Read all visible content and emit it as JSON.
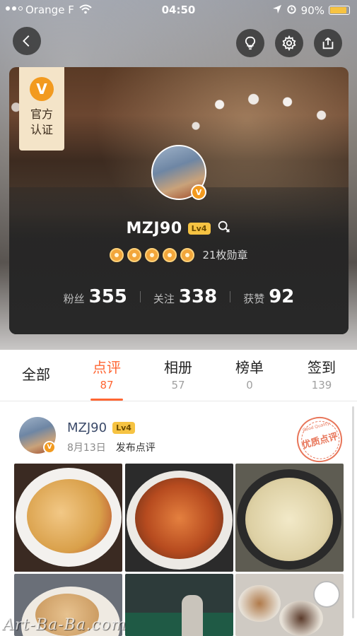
{
  "status_bar": {
    "carrier": "Orange F",
    "time": "04:50",
    "battery": "90%",
    "battery_level": 0.9,
    "icons": [
      "signal-icon",
      "wifi-icon",
      "location-icon",
      "alarm-icon",
      "battery-icon"
    ]
  },
  "header_buttons": {
    "back": "back-icon",
    "hint": "lightbulb-icon",
    "settings": "gear-icon",
    "share": "share-icon"
  },
  "profile": {
    "official_badge_letter": "V",
    "official_badge_text": "官方\n认证",
    "avatar_badge_letter": "V",
    "username": "MZJ90",
    "level": "Lv4",
    "medals_count_text": "21枚勋章",
    "medal_icons": 5,
    "stats": [
      {
        "label": "粉丝",
        "value": "355"
      },
      {
        "label": "关注",
        "value": "338"
      },
      {
        "label": "获赞",
        "value": "92"
      }
    ]
  },
  "tabs": [
    {
      "label": "全部",
      "count": ""
    },
    {
      "label": "点评",
      "count": "87",
      "active": true
    },
    {
      "label": "相册",
      "count": "57"
    },
    {
      "label": "榜单",
      "count": "0"
    },
    {
      "label": "签到",
      "count": "139"
    }
  ],
  "post": {
    "username": "MZJ90",
    "level": "Lv4",
    "avatar_badge_letter": "V",
    "date": "8月13日",
    "action": "发布点评",
    "stamp_text": "优质点评",
    "stamp_sub": "Good Quality"
  },
  "watermark": "Art-Ba-Ba.com",
  "colors": {
    "accent": "#ff6633",
    "level_badge": "#f6c342",
    "official_orange": "#f29a1f",
    "username_blue": "#3b4a69"
  }
}
